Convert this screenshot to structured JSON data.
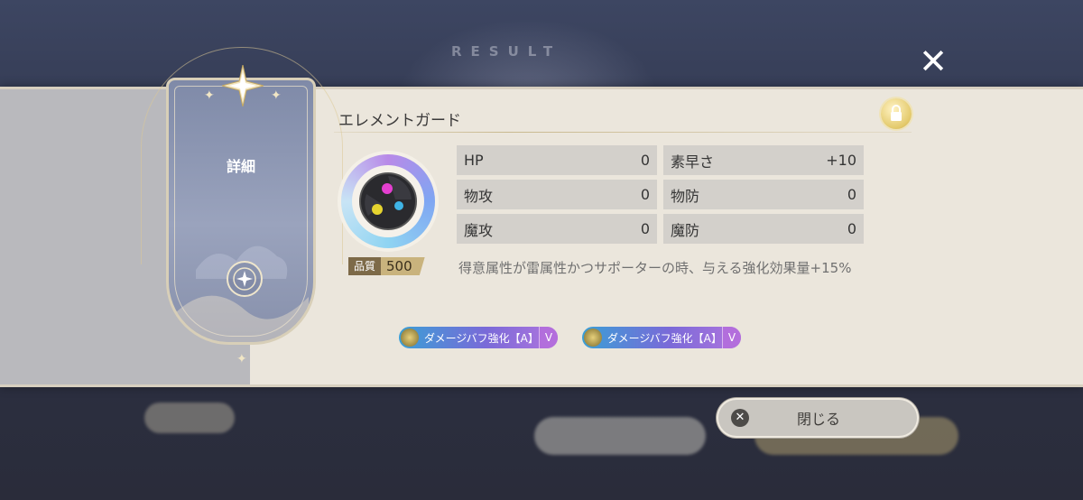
{
  "background": {
    "title_text": "RESULT"
  },
  "card": {
    "title": "詳細"
  },
  "item": {
    "name": "エレメントガード",
    "quality_label": "品質",
    "quality_value": "500",
    "effect_text": "得意属性が雷属性かつサポーターの時、与える強化効果量+15%"
  },
  "stats": [
    {
      "label": "HP",
      "value": "0"
    },
    {
      "label": "素早さ",
      "value": "+10"
    },
    {
      "label": "物攻",
      "value": "0"
    },
    {
      "label": "物防",
      "value": "0"
    },
    {
      "label": "魔攻",
      "value": "0"
    },
    {
      "label": "魔防",
      "value": "0"
    }
  ],
  "skills": [
    {
      "label": "ダメージバフ強化【A】",
      "rank": "V"
    },
    {
      "label": "ダメージバフ強化【A】",
      "rank": "V"
    }
  ],
  "buttons": {
    "close_label": "閉じる",
    "close_icon_glyph": "✕",
    "dismiss_glyph": "✕"
  },
  "icons": {
    "lock": "lock-icon",
    "star": "star-emblem-icon",
    "accessory": "element-guard-icon"
  },
  "colors": {
    "panel": "#ebe6dc",
    "stat_cell": "#d3d0cb",
    "skill_gradient_start": "#3a9fd6",
    "skill_gradient_end": "#b075de",
    "quality_gold": "#c9b37d"
  }
}
